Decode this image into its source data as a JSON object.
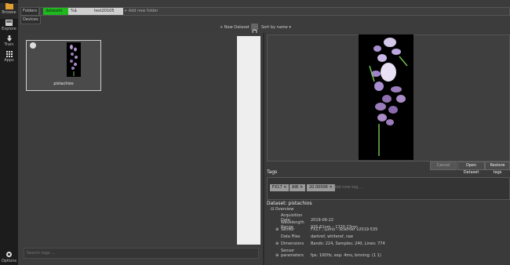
{
  "sidebar": {
    "items": [
      {
        "label": "Browse",
        "icon": "folder-icon"
      },
      {
        "label": "Explore",
        "icon": "explore-icon"
      },
      {
        "label": "Train",
        "icon": "train-icon"
      },
      {
        "label": "Apps",
        "icon": "apps-icon"
      }
    ],
    "bottom": {
      "label": "Options",
      "icon": "gear-icon"
    }
  },
  "toolbar": {
    "folders_label": "Folders",
    "devices_label": "Devices",
    "crumbs": [
      "datasets",
      "%$",
      "test20105",
      "+ Add new folder"
    ],
    "new_dataset": "+ New Dataset",
    "sort": "Sort by name ▾"
  },
  "dataset_card": {
    "name": "pistachios"
  },
  "search": {
    "placeholder": "Search tags ..."
  },
  "actions": {
    "cancel": "Cancel",
    "open": "Open Dataset",
    "restore": "Restore tags"
  },
  "tags": {
    "title": "Tags",
    "chips": [
      "FX17",
      "AIR",
      "20.00006"
    ],
    "add_placeholder": "Add new tag ..."
  },
  "dataset": {
    "title": "Dataset: pistachios",
    "overview": "Overview",
    "rows": [
      {
        "key": "Acquisition Date",
        "value": "2019-06-22",
        "expand": false
      },
      {
        "key": "Wavelength Range",
        "value": "935.61nm – 1720.23nm",
        "expand": false
      },
      {
        "key": "Sensor",
        "value": "FX17 , Lumo - Scanner v2019-535",
        "expand": true
      },
      {
        "key": "Data Files",
        "value": "darkref, whiteref, raw",
        "expand": false
      },
      {
        "key": "Dimensions",
        "value": "Bands: 224, Samples: 240, Lines: 774",
        "expand": true
      },
      {
        "key": "Sensor parameters",
        "value": "fps: 100Hz, exp. 4ms, binning: (1 1)",
        "expand": true
      }
    ]
  },
  "colors": {
    "accent_green": "#1fb81f",
    "bg_dark": "#1c1c1c",
    "folder_icon": "#e0a030"
  }
}
